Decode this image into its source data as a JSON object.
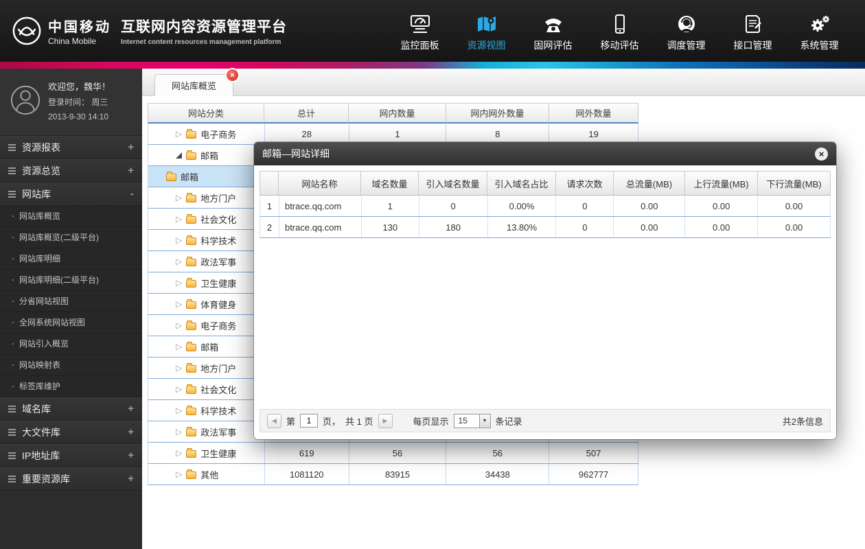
{
  "icons": {
    "close": "×",
    "prev": "◀",
    "next": "▶",
    "caret": "▼",
    "bullet": "·",
    "collapsed_triangle": "▷"
  },
  "header": {
    "brand_cn": "中国移动",
    "brand_en": "China Mobile",
    "title_cn": "互联网内容资源管理平台",
    "title_en": "Internet content resources management platform",
    "nav": [
      {
        "id": "dashboard",
        "label": "监控面板",
        "icon": "dashboard-icon",
        "active": false
      },
      {
        "id": "resource-view",
        "label": "资源视图",
        "icon": "map-icon",
        "active": true
      },
      {
        "id": "fixed-eval",
        "label": "固网评估",
        "icon": "telephone-icon",
        "active": false
      },
      {
        "id": "mobile-eval",
        "label": "移动评估",
        "icon": "mobile-icon",
        "active": false
      },
      {
        "id": "dispatch",
        "label": "调度管理",
        "icon": "operator-icon",
        "active": false
      },
      {
        "id": "interface",
        "label": "接口管理",
        "icon": "document-icon",
        "active": false
      },
      {
        "id": "system",
        "label": "系统管理",
        "icon": "gears-icon",
        "active": false
      }
    ]
  },
  "sidebar": {
    "welcome": "欢迎您，魏华！",
    "login_line1": "登录时间： 周三",
    "login_line2": "2013-9-30  14:10",
    "sections": [
      {
        "id": "resource-report",
        "label": "资源报表",
        "toggle": "+",
        "items": []
      },
      {
        "id": "resource-overview",
        "label": "资源总览",
        "toggle": "+",
        "items": []
      },
      {
        "id": "website-lib",
        "label": "网站库",
        "toggle": "-",
        "items": [
          "网站库概览",
          "网站库概览(二级平台)",
          "网站库明细",
          "网站库明细(二级平台)",
          "分省网站视图",
          "全网系统网站视图",
          "网站引入概览",
          "网站映射表",
          "标签库维护"
        ]
      },
      {
        "id": "domain-lib",
        "label": "域名库",
        "toggle": "+",
        "items": []
      },
      {
        "id": "bigfile-lib",
        "label": "大文件库",
        "toggle": "+",
        "items": []
      },
      {
        "id": "ip-lib",
        "label": "IP地址库",
        "toggle": "+",
        "items": []
      },
      {
        "id": "important-lib",
        "label": "重要资源库",
        "toggle": "+",
        "items": []
      }
    ]
  },
  "main": {
    "tab_label": "网站库概览",
    "table": {
      "headers": [
        "网站分类",
        "总计",
        "网内数量",
        "网内网外数量",
        "网外数量"
      ],
      "rows": [
        {
          "level": 0,
          "expand": "collapsed",
          "selected": false,
          "label": "电子商务",
          "values": [
            "28",
            "1",
            "8",
            "19"
          ]
        },
        {
          "level": 0,
          "expand": "expanded",
          "selected": false,
          "label": "邮箱",
          "values": [
            "",
            "",
            "",
            ""
          ]
        },
        {
          "level": 1,
          "expand": "none",
          "selected": true,
          "label": "邮箱",
          "values": [
            "",
            "",
            "",
            ""
          ]
        },
        {
          "level": 0,
          "expand": "collapsed",
          "selected": false,
          "label": "地方门户",
          "values": [
            "",
            "",
            "",
            ""
          ]
        },
        {
          "level": 0,
          "expand": "collapsed",
          "selected": false,
          "label": "社会文化",
          "values": [
            "",
            "",
            "",
            ""
          ]
        },
        {
          "level": 0,
          "expand": "collapsed",
          "selected": false,
          "label": "科学技术",
          "values": [
            "",
            "",
            "",
            ""
          ]
        },
        {
          "level": 0,
          "expand": "collapsed",
          "selected": false,
          "label": "政法军事",
          "values": [
            "",
            "",
            "",
            ""
          ]
        },
        {
          "level": 0,
          "expand": "collapsed",
          "selected": false,
          "label": "卫生健康",
          "values": [
            "",
            "",
            "",
            ""
          ]
        },
        {
          "level": 0,
          "expand": "collapsed",
          "selected": false,
          "label": "体育健身",
          "values": [
            "",
            "",
            "",
            ""
          ]
        },
        {
          "level": 0,
          "expand": "collapsed",
          "selected": false,
          "label": "电子商务",
          "values": [
            "",
            "",
            "",
            ""
          ]
        },
        {
          "level": 0,
          "expand": "collapsed",
          "selected": false,
          "label": "邮箱",
          "values": [
            "",
            "",
            "",
            ""
          ]
        },
        {
          "level": 0,
          "expand": "collapsed",
          "selected": false,
          "label": "地方门户",
          "values": [
            "",
            "",
            "",
            ""
          ]
        },
        {
          "level": 0,
          "expand": "collapsed",
          "selected": false,
          "label": "社会文化",
          "values": [
            "",
            "",
            "",
            ""
          ]
        },
        {
          "level": 0,
          "expand": "collapsed",
          "selected": false,
          "label": "科学技术",
          "values": [
            "",
            "",
            "",
            ""
          ]
        },
        {
          "level": 0,
          "expand": "collapsed",
          "selected": false,
          "label": "政法军事",
          "values": [
            "",
            "",
            "",
            ""
          ]
        },
        {
          "level": 0,
          "expand": "collapsed",
          "selected": false,
          "label": "卫生健康",
          "values": [
            "619",
            "56",
            "56",
            "507"
          ]
        },
        {
          "level": 0,
          "expand": "collapsed",
          "selected": false,
          "label": "其他",
          "values": [
            "1081120",
            "83915",
            "34438",
            "962777"
          ]
        }
      ]
    }
  },
  "modal": {
    "title": "邮箱—网站详细",
    "table": {
      "headers": [
        "网站名称",
        "域名数量",
        "引入域名数量",
        "引入域名占比",
        "请求次数",
        "总流量(MB)",
        "上行流量(MB)",
        "下行流量(MB)"
      ],
      "rows": [
        {
          "index": "1",
          "name": "btrace.qq.com",
          "values": [
            "1",
            "0",
            "0.00%",
            "0",
            "0.00",
            "0.00",
            "0.00"
          ]
        },
        {
          "index": "2",
          "name": "btrace.qq.com",
          "values": [
            "130",
            "180",
            "13.80%",
            "0",
            "0.00",
            "0.00",
            "0.00"
          ]
        }
      ]
    },
    "pagination": {
      "label_page": "第",
      "page": "1",
      "label_page_suffix": "页，",
      "total_pages": "共 1 页",
      "per_page_label": "每页显示",
      "per_page": "15",
      "records_label": "条记录",
      "total_info": "共2条信息"
    }
  }
}
